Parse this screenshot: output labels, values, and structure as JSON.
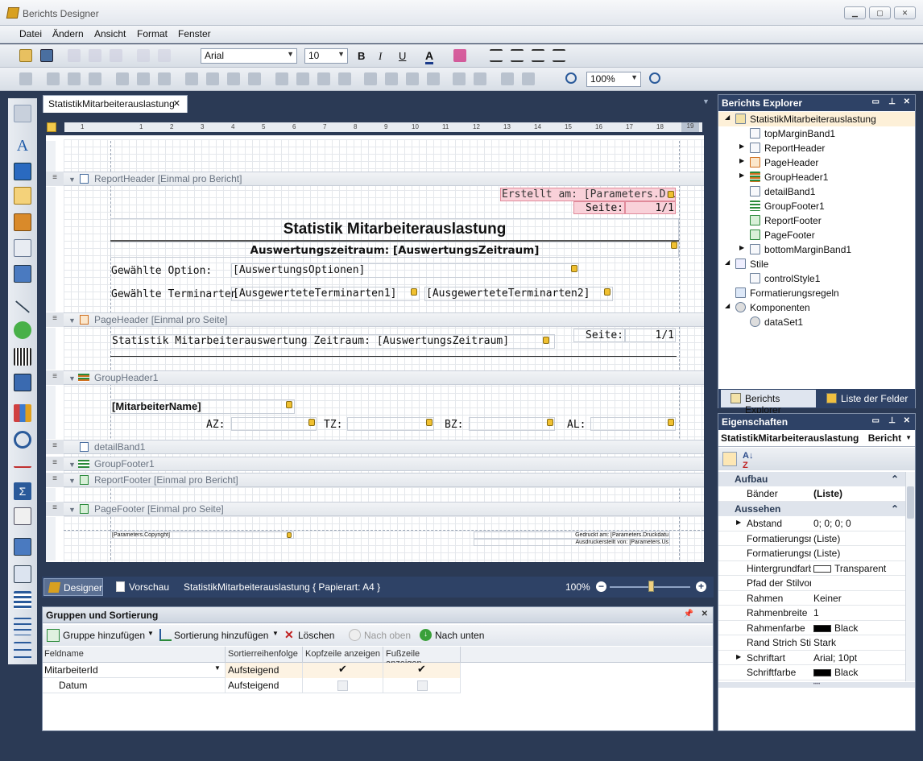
{
  "window": {
    "title": "Berichts Designer",
    "min": "▁",
    "max": "▢",
    "close": "✕"
  },
  "menu": [
    "Datei",
    "Ändern",
    "Ansicht",
    "Format",
    "Fenster"
  ],
  "toolbar": {
    "font": "Arial",
    "size": "10",
    "zoom": "100%"
  },
  "tabs": {
    "doc": "StatistikMitarbeiterauslastung",
    "close": "✕"
  },
  "ruler": [
    "1",
    "1",
    "2",
    "3",
    "4",
    "5",
    "6",
    "7",
    "8",
    "9",
    "10",
    "11",
    "12",
    "13",
    "14",
    "15",
    "16",
    "17",
    "18",
    "19"
  ],
  "bands": {
    "report_header": "ReportHeader [Einmal pro Bericht]",
    "page_header": "PageHeader [Einmal pro Seite]",
    "group_header": "GroupHeader1",
    "detail": "detailBand1",
    "group_footer": "GroupFooter1",
    "report_footer": "ReportFooter [Einmal pro Bericht]",
    "page_footer": "PageFooter [Einmal pro Seite]"
  },
  "report": {
    "created": "Erstellt am: [Parameters.Druck",
    "page_label": "Seite:",
    "page_val": "1/1",
    "title": "Statistik Mitarbeiterauslastung",
    "period": "Auswertungszeitraum: [AuswertungsZeitraum]",
    "option_label": "Gewählte Option:",
    "option_val": "[AuswertungsOptionen]",
    "term_label": "Gewählte Terminarten",
    "term1": "[AusgewerteteTerminarten1]",
    "term2": "[AusgewerteteTerminarten2]",
    "ph_title": "Statistik Mitarbeiterauswertung Zeitraum: [AuswertungsZeitraum]",
    "employee": "[MitarbeiterName]",
    "az": "AZ:",
    "tz": "TZ:",
    "bz": "BZ:",
    "al": "AL:",
    "copyright": "[Parameters.Copyright]",
    "printed": "Gedruckt am: [Parameters.Druckdatu",
    "printed_by": "Ausdruckerstellt von: [Parameters.Us"
  },
  "status": {
    "designer": "Designer",
    "preview": "Vorschau",
    "info": "StatistikMitarbeiterauslastung { Papierart: A4 }",
    "zoom": "100%"
  },
  "groups": {
    "title": "Gruppen und Sortierung",
    "add_group": "Gruppe hinzufügen",
    "add_sort": "Sortierung hinzufügen",
    "delete": "Löschen",
    "up": "Nach oben",
    "down": "Nach unten",
    "cols": [
      "Feldname",
      "Sortierreihenfolge",
      "Kopfzeile anzeigen",
      "Fußzeile anzeigen"
    ],
    "rows": [
      {
        "field": "MitarbeiterId",
        "order": "Aufsteigend",
        "head": "✔",
        "foot": "✔"
      },
      {
        "field": "Datum",
        "order": "Aufsteigend",
        "head": "",
        "foot": ""
      }
    ]
  },
  "explorer": {
    "title": "Berichts Explorer",
    "items": [
      "StatistikMitarbeiterauslastung",
      "topMarginBand1",
      "ReportHeader",
      "PageHeader",
      "GroupHeader1",
      "detailBand1",
      "GroupFooter1",
      "ReportFooter",
      "PageFooter",
      "bottomMarginBand1",
      "Stile",
      "controlStyle1",
      "Formatierungsregeln",
      "Komponenten",
      "dataSet1"
    ],
    "tab1": "Berichts Explorer",
    "tab2": "Liste der Felder"
  },
  "properties": {
    "title": "Eigenschaften",
    "object": "StatistikMitarbeiterauslastung",
    "object_type": "Bericht",
    "cat1": "Aufbau",
    "cat2": "Aussehen",
    "rows": [
      {
        "n": "Bänder",
        "v": "(Liste)"
      },
      {
        "n": "Abstand",
        "v": "0; 0; 0; 0"
      },
      {
        "n": "Formatierungsre",
        "v": "(Liste)"
      },
      {
        "n": "Formatierungsre",
        "v": "(Liste)"
      },
      {
        "n": "Hintergrundfarb",
        "v": "Transparent"
      },
      {
        "n": "Pfad der Stilvorl",
        "v": ""
      },
      {
        "n": "Rahmen",
        "v": "Keiner"
      },
      {
        "n": "Rahmenbreite",
        "v": "1"
      },
      {
        "n": "Rahmenfarbe",
        "v": "Black"
      },
      {
        "n": "Rand Strich Stil",
        "v": "Stark"
      },
      {
        "n": "Schriftart",
        "v": "Arial; 10pt"
      },
      {
        "n": "Schriftfarbe",
        "v": "Black"
      }
    ]
  }
}
